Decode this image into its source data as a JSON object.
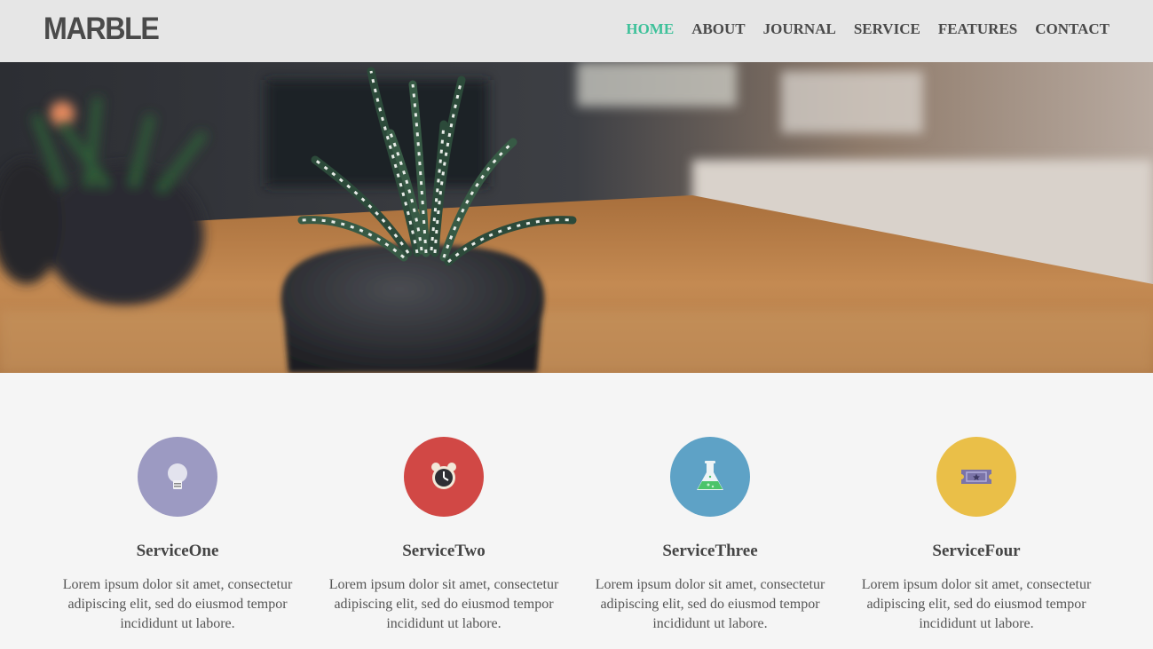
{
  "brand": {
    "logo": "MARBLE"
  },
  "nav": {
    "items": [
      {
        "label": "HOME",
        "active": true
      },
      {
        "label": "ABOUT"
      },
      {
        "label": "JOURNAL"
      },
      {
        "label": "SERVICE"
      },
      {
        "label": "FEATURES"
      },
      {
        "label": "CONTACT"
      }
    ],
    "active_color": "#3ec19a"
  },
  "hero": {
    "image": "potted succulent plant on wooden table"
  },
  "services": [
    {
      "title": "ServiceOne",
      "text": "Lorem ipsum dolor sit amet, consectetur adipiscing elit, sed do eiusmod tempor incididunt ut labore.",
      "icon": "lightbulb-icon",
      "color": "#9c9ac2"
    },
    {
      "title": "ServiceTwo",
      "text": "Lorem ipsum dolor sit amet, consectetur adipiscing elit, sed do eiusmod tempor incididunt ut labore.",
      "icon": "alarm-clock-icon",
      "color": "#d14845"
    },
    {
      "title": "ServiceThree",
      "text": "Lorem ipsum dolor sit amet, consectetur adipiscing elit, sed do eiusmod tempor incididunt ut labore.",
      "icon": "flask-icon",
      "color": "#5ea2c6"
    },
    {
      "title": "ServiceFour",
      "text": "Lorem ipsum dolor sit amet, consectetur adipiscing elit, sed do eiusmod tempor incididunt ut labore.",
      "icon": "ticket-icon",
      "color": "#eabf48"
    }
  ]
}
